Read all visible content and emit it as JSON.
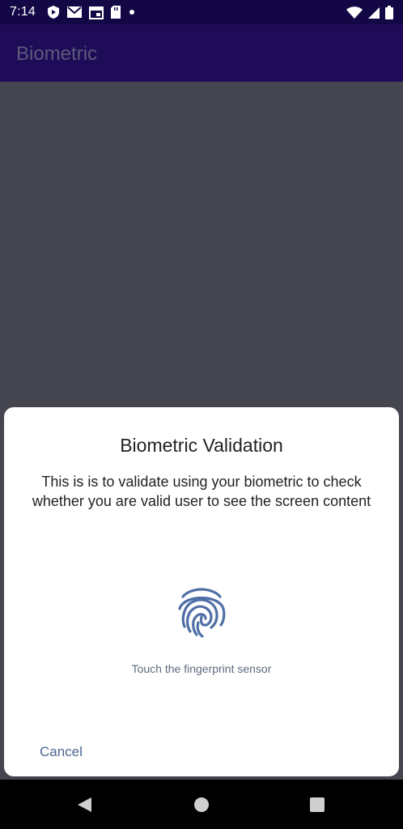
{
  "status_bar": {
    "time": "7:14",
    "left_icons": [
      "shield-play-icon",
      "gmail-icon",
      "calendar-icon",
      "sd-card-icon",
      "dot-icon"
    ],
    "right_icons": [
      "wifi-icon",
      "signal-icon",
      "battery-icon"
    ]
  },
  "app_bar": {
    "title": "Biometric"
  },
  "dialog": {
    "title": "Biometric Validation",
    "description": "This is is to validate using your biometric to check whether you are valid user to see the screen content",
    "icon": "fingerprint-icon",
    "hint": "Touch the fingerprint sensor",
    "cancel_label": "Cancel"
  },
  "nav_bar": {
    "buttons": [
      "back-icon",
      "home-icon",
      "recents-icon"
    ]
  },
  "colors": {
    "status_bar": "#140746",
    "app_bar": "#1f0c59",
    "scrim": "#45454f",
    "dialog_bg": "#ffffff",
    "accent": "#4a6591",
    "fingerprint": "#4f6fa6"
  }
}
